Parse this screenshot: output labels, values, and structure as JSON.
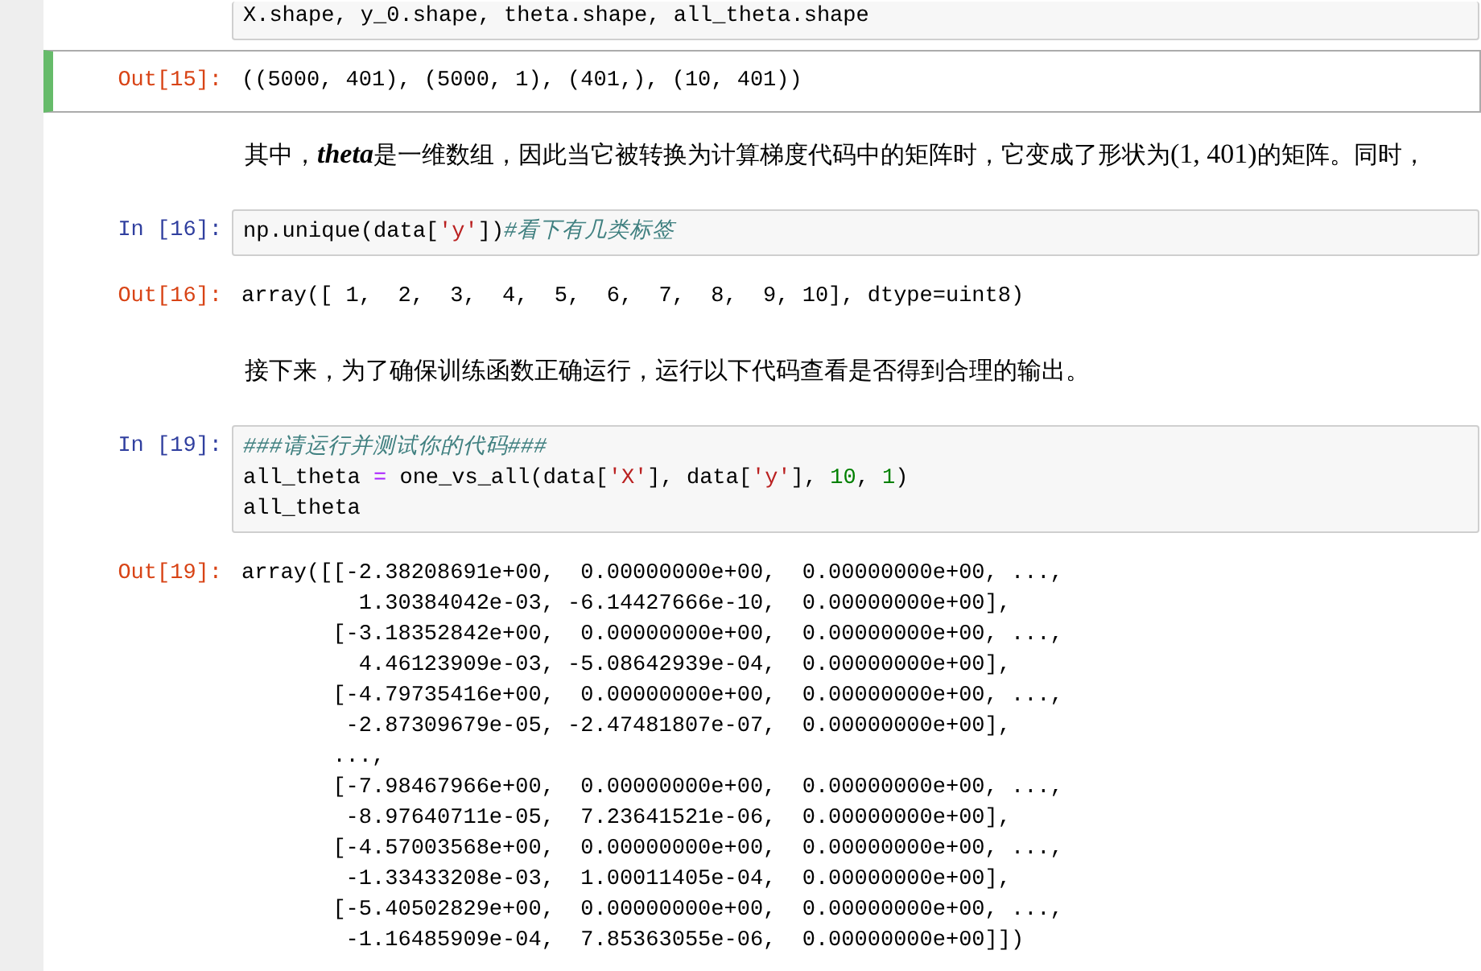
{
  "cells": [
    {
      "kind": "code",
      "selected": false,
      "lines": [
        [
          {
            "t": "X.shape, y_0.shape, theta.shape, all_theta.shape",
            "kind": "plain"
          }
        ]
      ]
    },
    {
      "kind": "output",
      "prompt": "Out[15]:",
      "selected": true,
      "lines": [
        "((5000, 401), (5000, 1), (401,), (10, 401))"
      ]
    },
    {
      "kind": "markdown",
      "parts": [
        {
          "t": "其中，",
          "kind": "text"
        },
        {
          "t": "theta",
          "kind": "var"
        },
        {
          "t": "是一维数组，因此当它被转换为计算梯度代码中的矩阵时，它变成了形状为",
          "kind": "text"
        },
        {
          "t": "(1, 401)",
          "kind": "math"
        },
        {
          "t": "的矩阵。同时，",
          "kind": "text"
        }
      ]
    },
    {
      "kind": "code",
      "prompt": "In  [16]:",
      "selected": false,
      "lines": [
        [
          {
            "t": "np.unique(data[",
            "kind": "plain"
          },
          {
            "t": "'y'",
            "kind": "string"
          },
          {
            "t": "])",
            "kind": "plain"
          },
          {
            "t": "#看下有几类标签",
            "kind": "comment"
          }
        ]
      ]
    },
    {
      "kind": "output",
      "prompt": "Out[16]:",
      "selected": false,
      "lines": [
        "array([ 1,  2,  3,  4,  5,  6,  7,  8,  9, 10], dtype=uint8)"
      ]
    },
    {
      "kind": "markdown",
      "parts": [
        {
          "t": "接下来，为了确保训练函数正确运行，运行以下代码查看是否得到合理的输出。",
          "kind": "text"
        }
      ]
    },
    {
      "kind": "code",
      "prompt": "In  [19]:",
      "selected": false,
      "lines": [
        [
          {
            "t": "###请运行并测试你的代码###",
            "kind": "comment"
          }
        ],
        [
          {
            "t": "all_theta ",
            "kind": "plain"
          },
          {
            "t": "=",
            "kind": "operator"
          },
          {
            "t": " one_vs_all(data[",
            "kind": "plain"
          },
          {
            "t": "'X'",
            "kind": "string"
          },
          {
            "t": "], data[",
            "kind": "plain"
          },
          {
            "t": "'y'",
            "kind": "string"
          },
          {
            "t": "], ",
            "kind": "plain"
          },
          {
            "t": "10",
            "kind": "number"
          },
          {
            "t": ", ",
            "kind": "plain"
          },
          {
            "t": "1",
            "kind": "number"
          },
          {
            "t": ")",
            "kind": "plain"
          }
        ],
        [
          {
            "t": "all_theta",
            "kind": "plain"
          }
        ]
      ]
    },
    {
      "kind": "output",
      "prompt": "Out[19]:",
      "selected": false,
      "lines": [
        "array([[-2.38208691e+00,  0.00000000e+00,  0.00000000e+00, ...,",
        "         1.30384042e-03, -6.14427666e-10,  0.00000000e+00],",
        "       [-3.18352842e+00,  0.00000000e+00,  0.00000000e+00, ...,",
        "         4.46123909e-03, -5.08642939e-04,  0.00000000e+00],",
        "       [-4.79735416e+00,  0.00000000e+00,  0.00000000e+00, ...,",
        "        -2.87309679e-05, -2.47481807e-07,  0.00000000e+00],",
        "       ...,",
        "       [-7.98467966e+00,  0.00000000e+00,  0.00000000e+00, ...,",
        "        -8.97640711e-05,  7.23641521e-06,  0.00000000e+00],",
        "       [-4.57003568e+00,  0.00000000e+00,  0.00000000e+00, ...,",
        "        -1.33433208e-03,  1.00011405e-04,  0.00000000e+00],",
        "       [-5.40502829e+00,  0.00000000e+00,  0.00000000e+00, ...,",
        "        -1.16485909e-04,  7.85363055e-06,  0.00000000e+00]])"
      ]
    }
  ]
}
